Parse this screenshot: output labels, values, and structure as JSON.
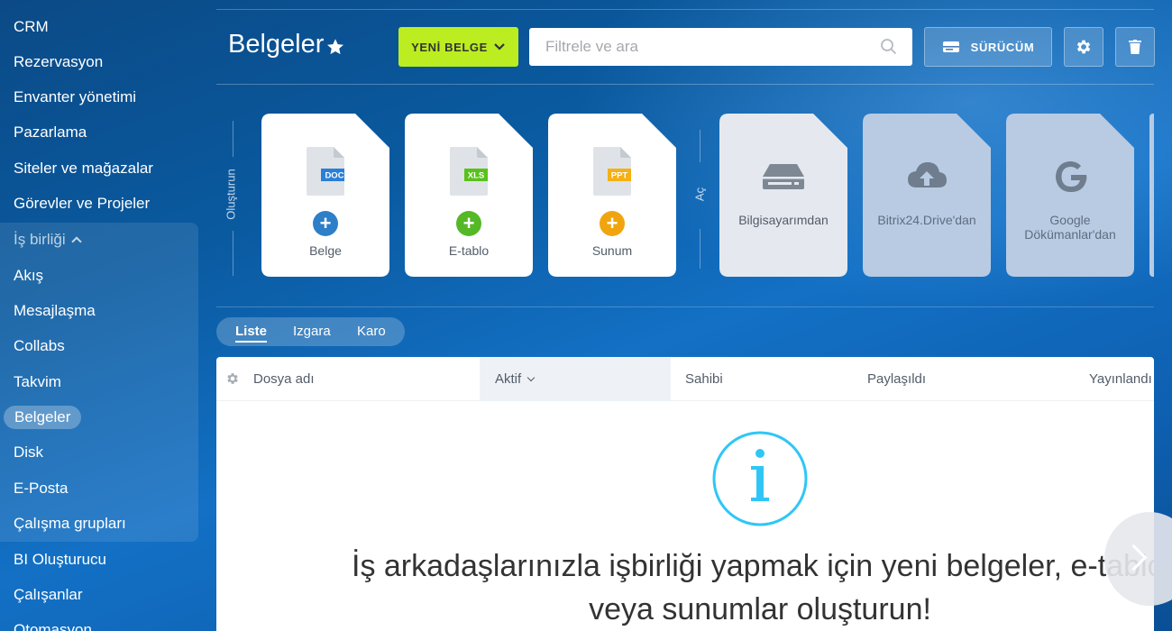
{
  "sidebar": {
    "items": [
      {
        "label": "CRM"
      },
      {
        "label": "Rezervasyon"
      },
      {
        "label": "Envanter yönetimi"
      },
      {
        "label": "Pazarlama"
      },
      {
        "label": "Siteler ve mağazalar"
      },
      {
        "label": "Görevler ve Projeler"
      },
      {
        "label": "İş birliği"
      },
      {
        "label": "Akış"
      },
      {
        "label": "Mesajlaşma"
      },
      {
        "label": "Collabs"
      },
      {
        "label": "Takvim"
      },
      {
        "label": "Belgeler"
      },
      {
        "label": "Disk"
      },
      {
        "label": "E-Posta"
      },
      {
        "label": "Çalışma grupları"
      },
      {
        "label": "BI Oluşturucu"
      },
      {
        "label": "Çalışanlar"
      },
      {
        "label": "Otomasyon"
      }
    ],
    "active_item": "Belgeler",
    "expanded_group": "İş birliği"
  },
  "header": {
    "title": "Belgeler",
    "new_button_label": "YENİ BELGE",
    "search_placeholder": "Filtrele ve ara",
    "drive_button_label": "SÜRÜCÜM",
    "accent_color": "#bbed21"
  },
  "create_section": {
    "label": "Oluşturun",
    "tiles": [
      {
        "label": "Belge",
        "badge": "DOC",
        "badge_color": "#2b7fd6",
        "plus_color": "#2d7fc8"
      },
      {
        "label": "E-tablo",
        "badge": "XLS",
        "badge_color": "#58c21b",
        "plus_color": "#55b826"
      },
      {
        "label": "Sunum",
        "badge": "PPT",
        "badge_color": "#f5b014",
        "plus_color": "#f0a50f"
      }
    ]
  },
  "open_section": {
    "label": "Aç",
    "tiles": [
      {
        "label": "Bilgisayarımdan",
        "icon": "hard-drive-icon"
      },
      {
        "label": "Bitrix24.Drive'dan",
        "icon": "cloud-upload-icon"
      },
      {
        "label": "Google Dökümanlar'dan",
        "icon": "google-icon"
      }
    ]
  },
  "view_switch": {
    "items": [
      "Liste",
      "Izgara",
      "Karo"
    ],
    "active": "Liste"
  },
  "table": {
    "columns": [
      "Dosya adı",
      "Aktif",
      "Sahibi",
      "Paylaşıldı",
      "Yayınlandı"
    ],
    "sorted_column": "Aktif"
  },
  "empty_state": {
    "message_line1": "İş arkadaşlarınızla işbirliği yapmak için yeni belgeler, e-tablolar",
    "message_line2": "veya sunumlar oluşturun!",
    "icon": "info-icon",
    "icon_color": "#2fc6f6"
  }
}
